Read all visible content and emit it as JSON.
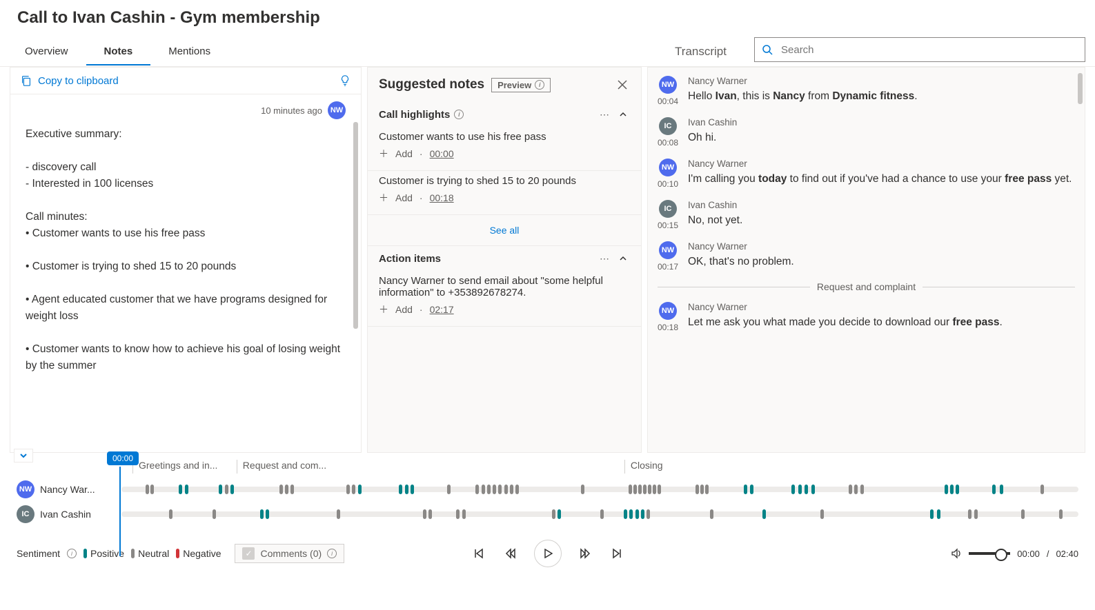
{
  "header": {
    "title": "Call to Ivan Cashin - Gym membership"
  },
  "tabs": {
    "overview": "Overview",
    "notes": "Notes",
    "mentions": "Mentions",
    "active": "Notes"
  },
  "search": {
    "placeholder": "Search",
    "transcript_label": "Transcript"
  },
  "notes_panel": {
    "copy_label": "Copy to clipboard",
    "meta_time": "10 minutes ago",
    "meta_initials": "NW",
    "content_lines": [
      "Executive summary:",
      "",
      "- discovery call",
      "- Interested in 100 licenses",
      "",
      "Call minutes:",
      "• Customer wants to use his free pass",
      "",
      "• Customer is trying to shed 15 to 20 pounds",
      "",
      "• Agent educated customer that we have programs designed for weight loss",
      "",
      "• Customer wants to know how to achieve his goal of losing weight by the summer",
      ""
    ]
  },
  "suggested": {
    "title": "Suggested notes",
    "preview_label": "Preview",
    "highlights_title": "Call highlights",
    "highlights": [
      {
        "text": "Customer wants to use his free pass",
        "time": "00:00"
      },
      {
        "text": "Customer is trying to shed 15 to 20 pounds",
        "time": "00:18"
      }
    ],
    "add_label": "Add",
    "see_all": "See all",
    "actions_title": "Action items",
    "actions": [
      {
        "text": "Nancy Warner to send email about \"some helpful information\" to +353892678274.",
        "time": "02:17"
      }
    ]
  },
  "transcript": [
    {
      "initials": "NW",
      "av": "nw",
      "name": "Nancy Warner",
      "time": "00:04",
      "html": "Hello <b>Ivan</b>, this is <b>Nancy</b> from <b>Dynamic fitness</b>."
    },
    {
      "initials": "IC",
      "av": "ic",
      "name": "Ivan Cashin",
      "time": "00:08",
      "html": "Oh hi."
    },
    {
      "initials": "NW",
      "av": "nw",
      "name": "Nancy Warner",
      "time": "00:10",
      "html": "I'm calling you <b>today</b> to find out if you've had a chance to use your <b>free pass</b> yet."
    },
    {
      "initials": "IC",
      "av": "ic",
      "name": "Ivan Cashin",
      "time": "00:15",
      "html": "No, not yet."
    },
    {
      "initials": "NW",
      "av": "nw",
      "name": "Nancy Warner",
      "time": "00:17",
      "html": "OK, that's no problem."
    },
    {
      "divider": "Request and complaint"
    },
    {
      "initials": "NW",
      "av": "nw",
      "name": "Nancy Warner",
      "time": "00:18",
      "html": "Let me ask you what made you decide to download our <b>free pass</b>."
    }
  ],
  "timeline": {
    "playhead": "00:00",
    "sections": [
      {
        "label": "Greetings and in...",
        "left_pct": 0,
        "width_pct": 11
      },
      {
        "label": "Request and com...",
        "left_pct": 11,
        "width_pct": 41
      },
      {
        "label": "Closing",
        "left_pct": 52,
        "width_pct": 48
      }
    ],
    "tracks": [
      {
        "initials": "NW",
        "av": "nw",
        "name": "Nancy War...",
        "segments": [
          {
            "p": 2.5,
            "s": "neu"
          },
          {
            "p": 3.0,
            "s": "neu"
          },
          {
            "p": 6.0,
            "s": "pos"
          },
          {
            "p": 6.6,
            "s": "pos"
          },
          {
            "p": 10.2,
            "s": "pos"
          },
          {
            "p": 10.8,
            "s": "neu"
          },
          {
            "p": 11.4,
            "s": "pos"
          },
          {
            "p": 16.5,
            "s": "neu"
          },
          {
            "p": 17.1,
            "s": "neu"
          },
          {
            "p": 17.7,
            "s": "neu"
          },
          {
            "p": 23.5,
            "s": "neu"
          },
          {
            "p": 24.1,
            "s": "neu"
          },
          {
            "p": 24.7,
            "s": "pos"
          },
          {
            "p": 29.0,
            "s": "pos"
          },
          {
            "p": 29.6,
            "s": "pos"
          },
          {
            "p": 30.2,
            "s": "pos"
          },
          {
            "p": 34.0,
            "s": "neu"
          },
          {
            "p": 37.0,
            "s": "neu"
          },
          {
            "p": 37.6,
            "s": "neu"
          },
          {
            "p": 38.2,
            "s": "neu"
          },
          {
            "p": 38.8,
            "s": "neu"
          },
          {
            "p": 39.4,
            "s": "neu"
          },
          {
            "p": 40.0,
            "s": "neu"
          },
          {
            "p": 40.6,
            "s": "neu"
          },
          {
            "p": 41.2,
            "s": "neu"
          },
          {
            "p": 48.0,
            "s": "neu"
          },
          {
            "p": 53.0,
            "s": "neu"
          },
          {
            "p": 53.5,
            "s": "neu"
          },
          {
            "p": 54.0,
            "s": "neu"
          },
          {
            "p": 54.5,
            "s": "neu"
          },
          {
            "p": 55.0,
            "s": "neu"
          },
          {
            "p": 55.5,
            "s": "neu"
          },
          {
            "p": 56.0,
            "s": "neu"
          },
          {
            "p": 60.0,
            "s": "neu"
          },
          {
            "p": 60.5,
            "s": "neu"
          },
          {
            "p": 61.0,
            "s": "neu"
          },
          {
            "p": 65.0,
            "s": "pos"
          },
          {
            "p": 65.7,
            "s": "pos"
          },
          {
            "p": 70.0,
            "s": "pos"
          },
          {
            "p": 70.7,
            "s": "pos"
          },
          {
            "p": 71.4,
            "s": "pos"
          },
          {
            "p": 72.1,
            "s": "pos"
          },
          {
            "p": 76.0,
            "s": "neu"
          },
          {
            "p": 76.6,
            "s": "neu"
          },
          {
            "p": 77.2,
            "s": "neu"
          },
          {
            "p": 86.0,
            "s": "pos"
          },
          {
            "p": 86.6,
            "s": "pos"
          },
          {
            "p": 87.2,
            "s": "pos"
          },
          {
            "p": 91.0,
            "s": "pos"
          },
          {
            "p": 91.8,
            "s": "pos"
          },
          {
            "p": 96.0,
            "s": "neu"
          }
        ]
      },
      {
        "initials": "IC",
        "av": "ic",
        "name": "Ivan Cashin",
        "segments": [
          {
            "p": 5.0,
            "s": "neu"
          },
          {
            "p": 9.5,
            "s": "neu"
          },
          {
            "p": 14.5,
            "s": "pos"
          },
          {
            "p": 15.1,
            "s": "pos"
          },
          {
            "p": 22.5,
            "s": "neu"
          },
          {
            "p": 31.5,
            "s": "neu"
          },
          {
            "p": 32.1,
            "s": "neu"
          },
          {
            "p": 35.0,
            "s": "neu"
          },
          {
            "p": 35.6,
            "s": "neu"
          },
          {
            "p": 45.0,
            "s": "neu"
          },
          {
            "p": 45.6,
            "s": "pos"
          },
          {
            "p": 50.0,
            "s": "neu"
          },
          {
            "p": 52.5,
            "s": "pos"
          },
          {
            "p": 53.1,
            "s": "pos"
          },
          {
            "p": 53.7,
            "s": "pos"
          },
          {
            "p": 54.3,
            "s": "pos"
          },
          {
            "p": 54.9,
            "s": "neu"
          },
          {
            "p": 61.5,
            "s": "neu"
          },
          {
            "p": 67.0,
            "s": "pos"
          },
          {
            "p": 73.0,
            "s": "neu"
          },
          {
            "p": 84.5,
            "s": "pos"
          },
          {
            "p": 85.2,
            "s": "pos"
          },
          {
            "p": 88.5,
            "s": "neu"
          },
          {
            "p": 89.1,
            "s": "neu"
          },
          {
            "p": 94.0,
            "s": "neu"
          },
          {
            "p": 98.0,
            "s": "neu"
          }
        ]
      }
    ]
  },
  "footer": {
    "sentiment_label": "Sentiment",
    "positive": "Positive",
    "neutral": "Neutral",
    "negative": "Negative",
    "comments": "Comments (0)",
    "current": "00:00",
    "total": "02:40"
  }
}
